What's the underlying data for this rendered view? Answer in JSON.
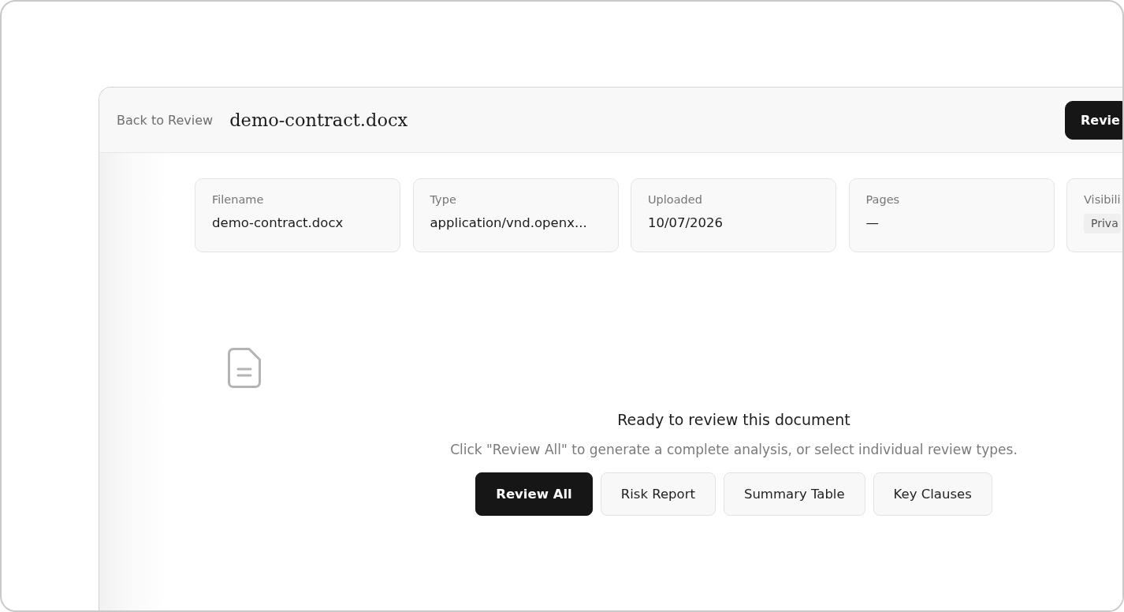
{
  "header": {
    "back_link": "Back to Review",
    "title": "demo-contract.docx",
    "action_button": {
      "label": "Revie",
      "kind": "primary"
    }
  },
  "info_cards": [
    {
      "label": "Filename",
      "value": "demo-contract.docx",
      "kind": "text"
    },
    {
      "label": "Type",
      "value": "application/vnd.openx...",
      "kind": "text"
    },
    {
      "label": "Uploaded",
      "value": "10/07/2026",
      "kind": "text"
    },
    {
      "label": "Pages",
      "value": "—",
      "kind": "text"
    },
    {
      "label": "Visibili",
      "value": "Priva",
      "kind": "badge"
    }
  ],
  "empty_state": {
    "heading": "Ready to review this document",
    "description": "Click \"Review All\" to generate a complete analysis, or select individual review types.",
    "buttons": [
      {
        "label": "Review All",
        "kind": "primary"
      },
      {
        "label": "Risk Report",
        "kind": "secondary"
      },
      {
        "label": "Summary Table",
        "kind": "secondary"
      },
      {
        "label": "Key Clauses",
        "kind": "secondary"
      }
    ]
  }
}
